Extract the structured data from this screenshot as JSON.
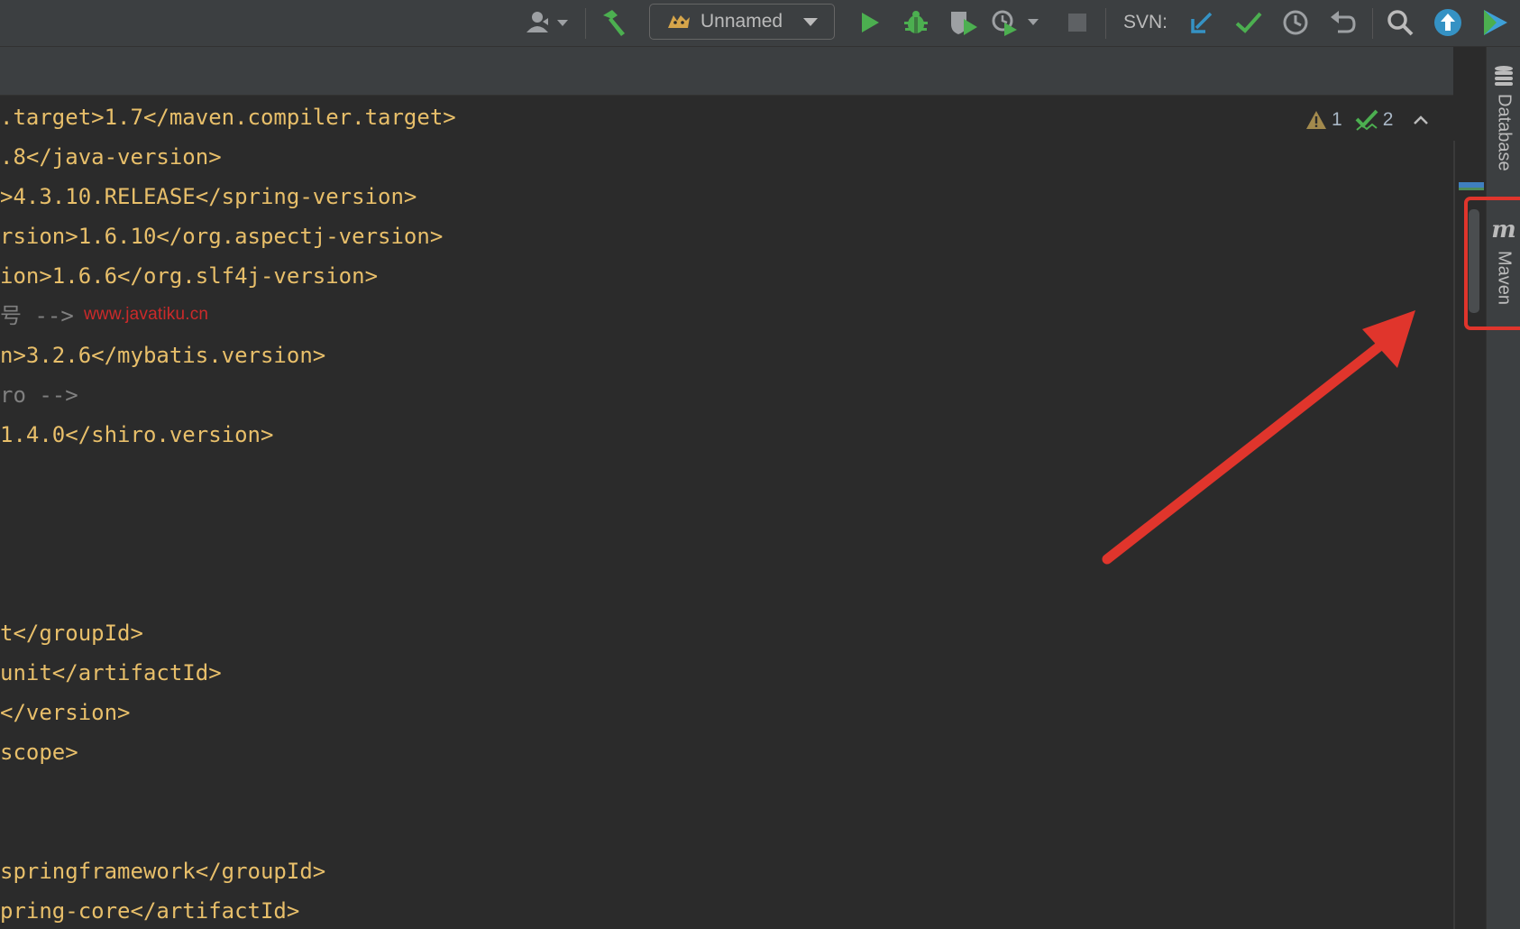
{
  "toolbar": {
    "user_icon": "user-icon",
    "build_icon": "hammer-icon",
    "run_config": {
      "icon": "tomcat-icon",
      "label": "Unnamed"
    },
    "run_icon": "run-icon",
    "debug_icon": "debug-icon",
    "coverage_icon": "coverage-icon",
    "profile_icon": "profile-icon",
    "stop_icon": "stop-icon",
    "svn_label": "SVN:",
    "svn_update_icon": "svn-update-icon",
    "svn_commit_icon": "svn-commit-icon",
    "svn_history_icon": "history-icon",
    "svn_rollback_icon": "rollback-icon",
    "search_icon": "search-icon",
    "upgrade_icon": "upgrade-icon",
    "plugin_icon": "plugin-icon"
  },
  "editor": {
    "lines": [
      {
        "text": ".target>1.7</maven.compiler.target>",
        "kind": "tag"
      },
      {
        "text": ".8</java-version>",
        "kind": "tag"
      },
      {
        "text": ">4.3.10.RELEASE</spring-version>",
        "kind": "tag"
      },
      {
        "text": "rsion>1.6.10</org.aspectj-version>",
        "kind": "tag"
      },
      {
        "text": "ion>1.6.6</org.slf4j-version>",
        "kind": "tag"
      },
      {
        "text": "号 -->",
        "kind": "comment"
      },
      {
        "text": "n>3.2.6</mybatis.version>",
        "kind": "tag"
      },
      {
        "text": "ro -->",
        "kind": "comment"
      },
      {
        "text": "1.4.0</shiro.version>",
        "kind": "tag"
      },
      {
        "text": "",
        "kind": "tag"
      },
      {
        "text": "",
        "kind": "tag"
      },
      {
        "text": "",
        "kind": "tag"
      },
      {
        "text": "",
        "kind": "tag"
      },
      {
        "text": "t</groupId>",
        "kind": "tag"
      },
      {
        "text": "unit</artifactId>",
        "kind": "tag"
      },
      {
        "text": "</version>",
        "kind": "tag"
      },
      {
        "text": "scope>",
        "kind": "tag"
      },
      {
        "text": "",
        "kind": "tag"
      },
      {
        "text": "",
        "kind": "tag"
      },
      {
        "text": "springframework</groupId>",
        "kind": "tag"
      },
      {
        "text": "pring-core</artifactId>",
        "kind": "tag"
      }
    ],
    "watermark": "www.javatiku.cn",
    "inspections": {
      "warnings": "1",
      "warning_icon": "warning-icon",
      "weak_warnings": "2",
      "weak_warning_icon": "check-icon",
      "prev_icon": "chevron-up-icon",
      "next_icon": "chevron-down-icon"
    }
  },
  "right_strip": {
    "database": {
      "label": "Database",
      "icon": "database-icon"
    },
    "maven": {
      "label": "Maven",
      "icon": "maven-icon"
    }
  },
  "annotation": {
    "arrow_color": "#e0352c",
    "highlight_color": "#e0352c"
  },
  "colors": {
    "code_tag": "#e8bf6a",
    "code_comment": "#808080",
    "run_green": "#4caf50",
    "svn_blue": "#3592c4"
  }
}
